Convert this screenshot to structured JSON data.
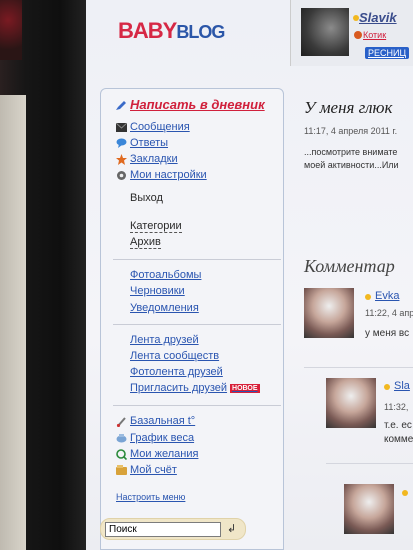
{
  "logo": {
    "part1": "BABY",
    "part2": "BLOG"
  },
  "user": {
    "name": "Slavik",
    "sub_label": "Котик",
    "button_label": "РЕСНИЦ"
  },
  "sidebar": {
    "write_label": "Написать в дневник",
    "items_top": [
      {
        "label": "Сообщения",
        "icon": "envelope-icon"
      },
      {
        "label": "Ответы",
        "icon": "speech-bubble-icon"
      },
      {
        "label": "Закладки",
        "icon": "star-icon"
      },
      {
        "label": "Мои настройки",
        "icon": "gear-icon"
      }
    ],
    "logout": "Выход",
    "categories": "Категории",
    "archive": "Архив",
    "group2": [
      "Фотоальбомы",
      "Черновики",
      "Уведомления"
    ],
    "group3": [
      "Лента друзей",
      "Лента сообществ",
      "Фотолента друзей",
      "Пригласить друзей"
    ],
    "new_badge": "НОВОЕ",
    "group4": [
      {
        "label": "Базальная t°",
        "icon": "thermometer-icon"
      },
      {
        "label": "График веса",
        "icon": "scale-icon"
      },
      {
        "label": "Мои желания",
        "icon": "wish-icon"
      },
      {
        "label": "Мой счёт",
        "icon": "wallet-icon"
      }
    ],
    "settings_menu": "Настроить меню",
    "search_placeholder": "Поиск",
    "search_enter": "↲"
  },
  "post": {
    "title": "У меня глюк",
    "date": "11:17, 4 апреля 2011 г.",
    "excerpt_line1": "...посмотрите внимате",
    "excerpt_line2": "моей активности...Или"
  },
  "comments": {
    "title": "Комментар",
    "items": [
      {
        "name": "Evka",
        "time": "11:22, 4 апр",
        "text": "у меня вс"
      },
      {
        "name": "Sla",
        "time": "11:32,",
        "text": "т.е. ес",
        "text2": "комме"
      },
      {
        "name": "",
        "time": "",
        "text": ""
      }
    ]
  }
}
